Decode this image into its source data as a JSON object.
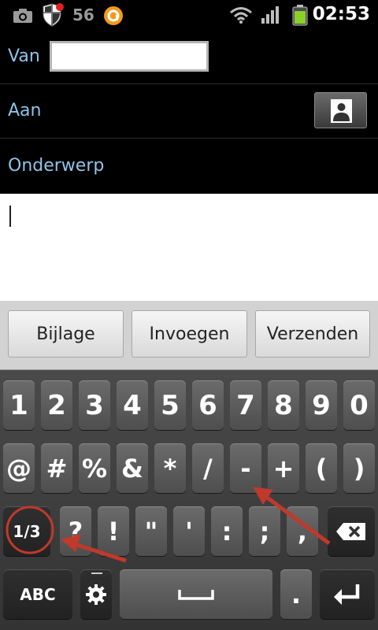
{
  "status_bar": {
    "notification_count": "56",
    "time": "02:53",
    "icons": [
      "camera-icon",
      "shield-icon",
      "orange-app-icon",
      "wifi-icon",
      "signal-icon",
      "battery-icon"
    ]
  },
  "compose": {
    "from_label": "Van",
    "from_value": "",
    "to_label": "Aan",
    "subject_label": "Onderwerp",
    "body_value": ""
  },
  "actions": {
    "attach": "Bijlage",
    "insert": "Invoegen",
    "send": "Verzenden"
  },
  "keyboard": {
    "row1": [
      "1",
      "2",
      "3",
      "4",
      "5",
      "6",
      "7",
      "8",
      "9",
      "0"
    ],
    "row2": [
      "@",
      "#",
      "%",
      "&",
      "*",
      "/",
      "-",
      "+",
      "(",
      ")"
    ],
    "row3": [
      "1/3",
      "?",
      "!",
      "\"",
      "'",
      ":",
      ";",
      ","
    ],
    "row4": {
      "abc": "ABC",
      "period": "."
    }
  },
  "colors": {
    "label_blue": "#8ec4ea",
    "annotation_red": "#c0392b"
  }
}
